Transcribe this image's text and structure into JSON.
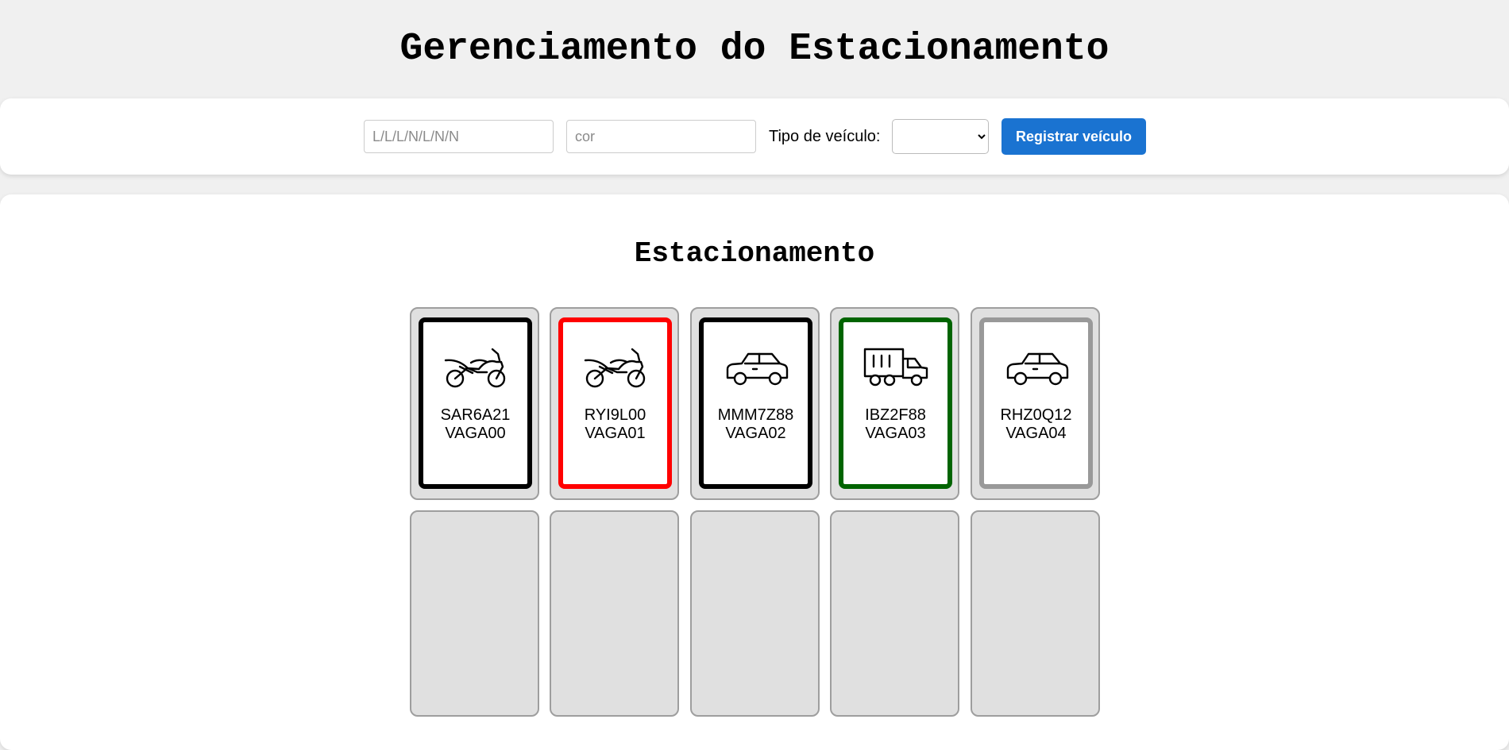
{
  "header": {
    "title": "Gerenciamento do Estacionamento"
  },
  "form": {
    "plate_placeholder": "L/L/L/N/L/N/N",
    "color_placeholder": "cor",
    "type_label": "Tipo de veículo:",
    "type_selected": "",
    "register_label": "Registrar veículo"
  },
  "lot": {
    "title": "Estacionamento",
    "occupied": [
      {
        "plate": "SAR6A21",
        "spot": "VAGA00",
        "type": "motorcycle",
        "icon": "motorcycle-icon",
        "border_color": "#000000"
      },
      {
        "plate": "RYI9L00",
        "spot": "VAGA01",
        "type": "motorcycle",
        "icon": "motorcycle-icon",
        "border_color": "#ff0000"
      },
      {
        "plate": "MMM7Z88",
        "spot": "VAGA02",
        "type": "car",
        "icon": "car-icon",
        "border_color": "#000000"
      },
      {
        "plate": "IBZ2F88",
        "spot": "VAGA03",
        "type": "truck",
        "icon": "truck-icon",
        "border_color": "#006400"
      },
      {
        "plate": "RHZ0Q12",
        "spot": "VAGA04",
        "type": "car",
        "icon": "car-icon",
        "border_color": "#999999"
      }
    ],
    "empty_slot_count": 5
  },
  "colors": {
    "accent": "#1a73d1",
    "page_background": "#f0f0f0",
    "slot_background": "#e0e0e0"
  }
}
